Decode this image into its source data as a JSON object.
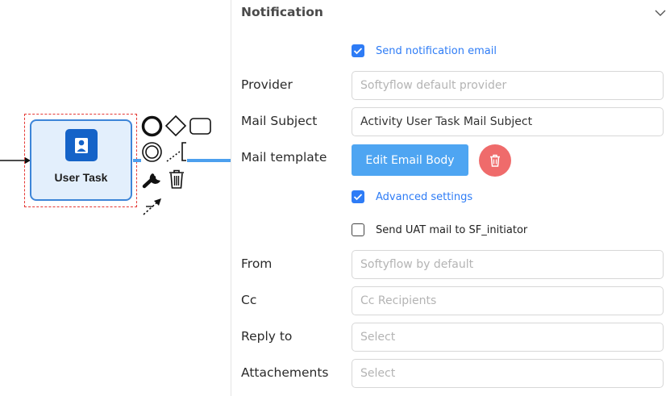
{
  "canvas": {
    "task_label": "User Task",
    "palette": [
      {
        "name": "start-event-icon"
      },
      {
        "name": "gateway-icon"
      },
      {
        "name": "task-shape-icon"
      },
      {
        "name": "intermediate-event-icon"
      },
      {
        "name": "text-annotation-icon"
      },
      {
        "name": "wrench-icon"
      },
      {
        "name": "trash-icon"
      },
      {
        "name": "connect-arrow-icon"
      }
    ],
    "colors": {
      "task_fill": "#e3effc",
      "task_border": "#3d85d8",
      "task_icon_bg": "#1563c8",
      "selection": "#e53935",
      "connector": "#4ca0ee"
    }
  },
  "panel": {
    "title": "Notification",
    "send_notification": {
      "label": "Send notification email",
      "checked": true
    },
    "provider": {
      "label": "Provider",
      "placeholder": "Softyflow default provider",
      "value": ""
    },
    "mail_subject": {
      "label": "Mail Subject",
      "value": "Activity User Task Mail Subject"
    },
    "mail_template": {
      "label": "Mail template",
      "button_label": "Edit Email Body"
    },
    "advanced_settings": {
      "label": "Advanced settings",
      "checked": true
    },
    "send_uat": {
      "label": "Send UAT mail to SF_initiator",
      "checked": false
    },
    "from": {
      "label": "From",
      "placeholder": "Softyflow by default",
      "value": ""
    },
    "cc": {
      "label": "Cc",
      "placeholder": "Cc Recipients",
      "value": ""
    },
    "reply_to": {
      "label": "Reply to",
      "placeholder": "Select",
      "value": ""
    },
    "attachments": {
      "label": "Attachements",
      "placeholder": "Select",
      "value": ""
    },
    "colors": {
      "accent": "#2e7cf6",
      "button": "#4ea5f2",
      "delete": "#ef6b6b"
    }
  }
}
